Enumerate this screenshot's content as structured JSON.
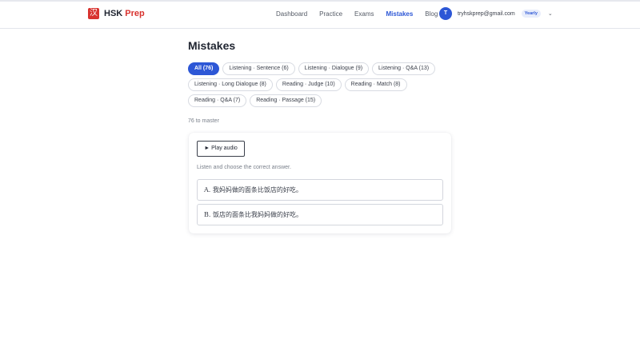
{
  "logo": {
    "mark": "汉",
    "name_main": "HSK",
    "name_accent": "Prep"
  },
  "nav": [
    {
      "label": "Dashboard",
      "active": false
    },
    {
      "label": "Practice",
      "active": false
    },
    {
      "label": "Exams",
      "active": false
    },
    {
      "label": "Mistakes",
      "active": true
    },
    {
      "label": "Blog",
      "active": false
    }
  ],
  "user": {
    "initial": "T",
    "email": "tryhskprep@gmail.com",
    "plan": "Yearly"
  },
  "page": {
    "title": "Mistakes",
    "count_text": "76 to master"
  },
  "filters": [
    {
      "label": "All (76)",
      "active": true
    },
    {
      "label": "Listening · Sentence (6)",
      "active": false
    },
    {
      "label": "Listening · Dialogue (9)",
      "active": false
    },
    {
      "label": "Listening · Q&A (13)",
      "active": false
    },
    {
      "label": "Listening · Long Dialogue (8)",
      "active": false
    },
    {
      "label": "Reading · Judge (10)",
      "active": false
    },
    {
      "label": "Reading · Match (8)",
      "active": false
    },
    {
      "label": "Reading · Q&A (7)",
      "active": false
    },
    {
      "label": "Reading · Passage (15)",
      "active": false
    }
  ],
  "question": {
    "play_label": "► Play audio",
    "instruction": "Listen and choose the correct answer.",
    "options": [
      {
        "text": "A. 我妈妈做的面条比饭店的好吃。"
      },
      {
        "text": "B. 饭店的面条比我妈妈做的好吃。"
      }
    ]
  },
  "colors": {
    "accent": "#2d57d6",
    "brand": "#d8332f"
  }
}
